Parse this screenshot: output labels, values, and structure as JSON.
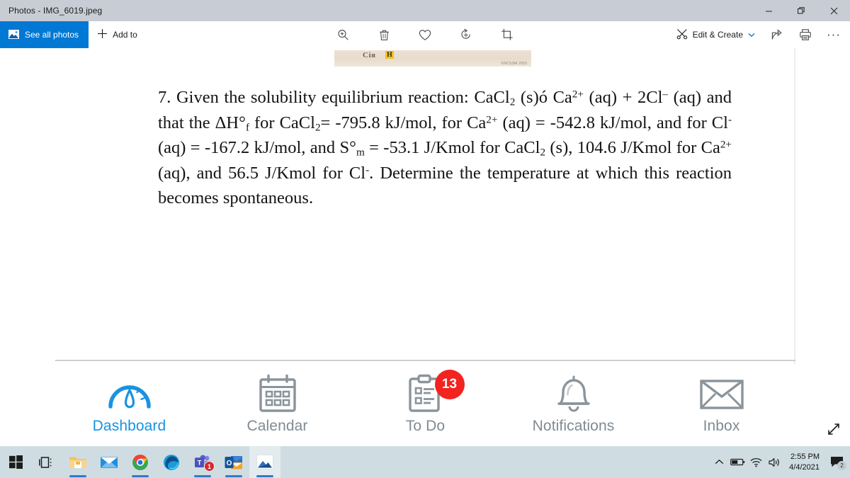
{
  "window": {
    "title": "Photos - IMG_6019.jpeg",
    "controls": [
      {
        "name": "minimize",
        "label": "—"
      },
      {
        "name": "restore",
        "label": "❐"
      },
      {
        "name": "close",
        "label": "✕"
      }
    ]
  },
  "commandbar": {
    "see_all_photos": "See all photos",
    "add_to": "Add to",
    "center_tools": [
      {
        "name": "zoom-icon",
        "label": "Zoom"
      },
      {
        "name": "delete-icon",
        "label": "Delete"
      },
      {
        "name": "favorite-icon",
        "label": "Add to favorites"
      },
      {
        "name": "rotate-icon",
        "label": "Rotate"
      },
      {
        "name": "crop-icon",
        "label": "Crop & rotate"
      }
    ],
    "edit_create": "Edit & Create",
    "share": "Share",
    "print": "Print",
    "more": "···"
  },
  "photo": {
    "strip": {
      "fragment": "Сія",
      "highlight": "H",
      "watermark": "©NCSSM 2003"
    },
    "problem": {
      "number": "7.",
      "line1_a": "Given the solubility equilibrium reaction: CaCl",
      "line1_sub": "2",
      "line1_b": " (s)ó Ca",
      "line1_sup": "2+",
      "line1_c": " (aq)",
      "line2_a": "+ 2Cl",
      "line2_sup": "–",
      "line2_b": " (aq) and that the ΔH°",
      "line2_sub_f": "f",
      "line2_c": " for CaCl",
      "line2_sub2": "2",
      "line2_d": "= -795.8 kJ/mol, for",
      "line3_a": "Ca",
      "line3_sup": "2+",
      "line3_b": " (aq) = -542.8 kJ/mol, and for Cl",
      "line3_sup2": "-",
      "line3_c": " (aq) = -167.2 kJ/mol,",
      "line4_a": "and S°",
      "line4_sub": "m",
      "line4_b": " = -53.1 J/Kmol for CaCl",
      "line4_sub2": "2",
      "line4_c": " (s), 104.6 J/Kmol for Ca",
      "line4_sup": "2+",
      "line5_a": "(aq), and 56.5 J/Kmol for Cl",
      "line5_sup": "-",
      "line5_b": ". Determine the temperature at",
      "line6": "which this reaction becomes spontaneous."
    },
    "appnav": [
      {
        "name": "dashboard",
        "label": "Dashboard",
        "icon": "gauge-icon",
        "active": true,
        "badge": null
      },
      {
        "name": "calendar",
        "label": "Calendar",
        "icon": "calendar-icon",
        "active": false,
        "badge": null
      },
      {
        "name": "todo",
        "label": "To Do",
        "icon": "clipboard-icon",
        "active": false,
        "badge": "13"
      },
      {
        "name": "notifications",
        "label": "Notifications",
        "icon": "bell-icon",
        "active": false,
        "badge": null
      },
      {
        "name": "inbox",
        "label": "Inbox",
        "icon": "envelope-icon",
        "active": false,
        "badge": null
      }
    ]
  },
  "taskbar": {
    "buttons": [
      {
        "name": "start-button",
        "icon": "windows-icon",
        "active": false,
        "badge": null,
        "running": false
      },
      {
        "name": "task-view",
        "icon": "task-view-icon",
        "active": false,
        "badge": null,
        "running": false
      },
      {
        "name": "file-explorer",
        "icon": "folder-icon",
        "active": false,
        "badge": null,
        "running": true
      },
      {
        "name": "mail",
        "icon": "mail-icon",
        "active": false,
        "badge": null,
        "running": false
      },
      {
        "name": "chrome",
        "icon": "chrome-icon",
        "active": false,
        "badge": null,
        "running": true
      },
      {
        "name": "edge",
        "icon": "edge-icon",
        "active": false,
        "badge": null,
        "running": false
      },
      {
        "name": "teams",
        "icon": "teams-icon",
        "active": false,
        "badge": "1",
        "running": true
      },
      {
        "name": "outlook",
        "icon": "outlook-icon",
        "active": false,
        "badge": null,
        "running": true
      },
      {
        "name": "photos",
        "icon": "photos-icon",
        "active": true,
        "badge": null,
        "running": true
      }
    ],
    "tray": [
      {
        "name": "show-hidden-icons",
        "label": "∧"
      },
      {
        "name": "battery-icon",
        "label": "battery"
      },
      {
        "name": "network-icon",
        "label": "wifi"
      },
      {
        "name": "volume-icon",
        "label": "volume"
      }
    ],
    "time": "2:55 PM",
    "date": "4/4/2021",
    "action_center_badge": "2"
  },
  "colors": {
    "accent": "#0078d4",
    "titlebar": "#c8ccd4",
    "taskbar": "#cfdde2",
    "badge_red": "#f3231f",
    "nav_gray": "#7f8b92",
    "nav_active": "#1a92e0"
  }
}
